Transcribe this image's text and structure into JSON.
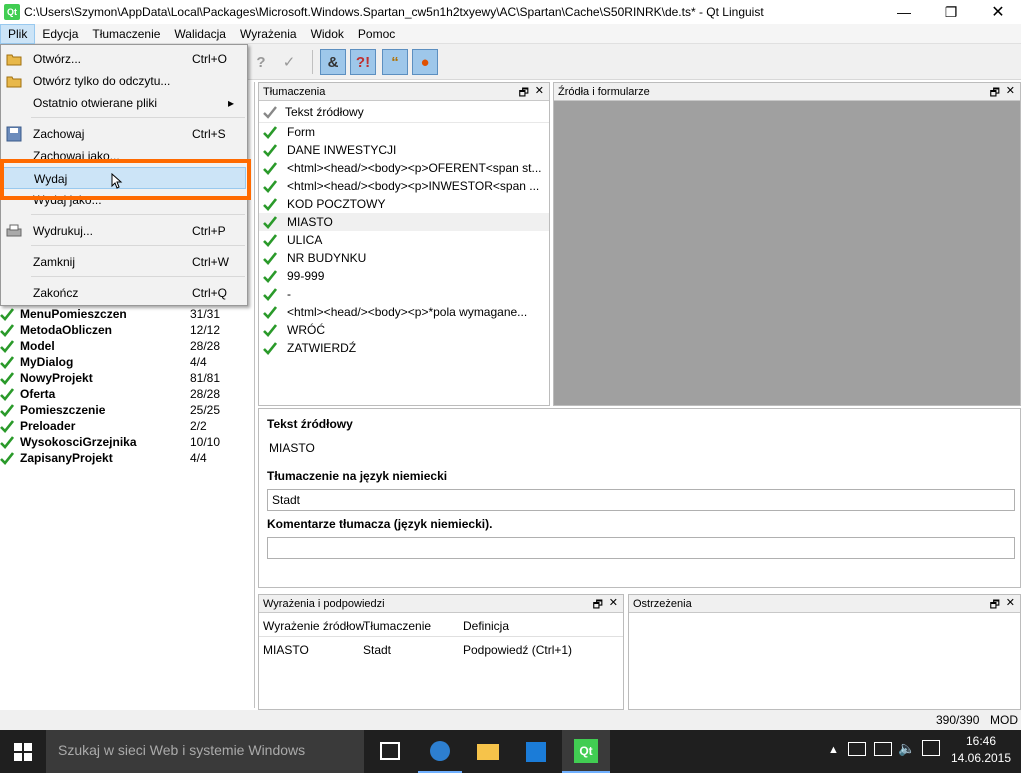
{
  "window": {
    "title": "C:\\Users\\Szymon\\AppData\\Local\\Packages\\Microsoft.Windows.Spartan_cw5n1h2txyewy\\AC\\Spartan\\Cache\\S50RINRK\\de.ts* - Qt Linguist",
    "app_icon": "Qt"
  },
  "menubar": [
    "Plik",
    "Edycja",
    "Tłumaczenie",
    "Walidacja",
    "Wyrażenia",
    "Widok",
    "Pomoc"
  ],
  "file_menu": {
    "items": [
      {
        "label": "Otwórz...",
        "shortcut": "Ctrl+O",
        "icon": "open-folder-icon"
      },
      {
        "label": "Otwórz tylko do odczytu...",
        "shortcut": "",
        "icon": "open-folder-icon"
      },
      {
        "label": "Ostatnio otwierane pliki",
        "shortcut": "",
        "submenu_arrow": "▸"
      },
      {
        "label": "Zachowaj",
        "shortcut": "Ctrl+S",
        "icon": "save-icon"
      },
      {
        "label": "Zachowaj jako...",
        "shortcut": ""
      },
      {
        "label": "Wydaj",
        "shortcut": ""
      },
      {
        "label": "Wydaj jako...",
        "shortcut": ""
      },
      {
        "label": "Wydrukuj...",
        "shortcut": "Ctrl+P",
        "icon": "printer-icon"
      },
      {
        "label": "Zamknij",
        "shortcut": "Ctrl+W"
      },
      {
        "label": "Zakończ",
        "shortcut": "Ctrl+Q"
      }
    ],
    "highlighted": "Wydaj"
  },
  "highlight_color": "#ff6a00",
  "contexts": [
    {
      "name": "MenuPomieszczen",
      "count": "31/31"
    },
    {
      "name": "MetodaObliczen",
      "count": "12/12"
    },
    {
      "name": "Model",
      "count": "28/28"
    },
    {
      "name": "MyDialog",
      "count": "4/4"
    },
    {
      "name": "NowyProjekt",
      "count": "81/81"
    },
    {
      "name": "Oferta",
      "count": "28/28"
    },
    {
      "name": "Pomieszczenie",
      "count": "25/25"
    },
    {
      "name": "Preloader",
      "count": "2/2"
    },
    {
      "name": "WysokosciGrzejnika",
      "count": "10/10"
    },
    {
      "name": "ZapisanyProjekt",
      "count": "4/4"
    }
  ],
  "translations_panel": {
    "title": "Tłumaczenia",
    "column": "Tekst źródłowy",
    "rows": [
      "Form",
      "DANE INWESTYCJI",
      "<html><head/><body><p>OFERENT<span st...",
      "<html><head/><body><p>INWESTOR<span ...",
      "KOD POCZTOWY",
      "MIASTO",
      "ULICA",
      "NR BUDYNKU",
      "99-999",
      "-",
      "<html><head/><body><p>*pola wymagane...",
      "WRÓĆ",
      "ZATWIERDŹ"
    ],
    "selected": "MIASTO"
  },
  "sources_panel": {
    "title": "Źródła i formularze"
  },
  "editor": {
    "source_label": "Tekst źródłowy",
    "source_text": "MIASTO",
    "translation_label": "Tłumaczenie na język niemiecki",
    "translation_value": "Stadt",
    "comments_label": "Komentarze tłumacza (język niemiecki).",
    "comments_value": ""
  },
  "phrases_panel": {
    "title": "Wyrażenia i podpowiedzi",
    "columns": [
      "Wyrażenie źródłow",
      "Tłumaczenie",
      "Definicja"
    ],
    "row": [
      "MIASTO",
      "Stadt",
      "Podpowiedź (Ctrl+1)"
    ]
  },
  "warnings_panel": {
    "title": "Ostrzeżenia"
  },
  "statusbar": {
    "progress": "390/390",
    "mode": "MOD"
  },
  "taskbar": {
    "search_placeholder": "Szukaj w sieci Web i systemie Windows",
    "time": "16:46",
    "date": "14.06.2015"
  },
  "panel_controls": {
    "float": "🗗",
    "close": "✕"
  }
}
